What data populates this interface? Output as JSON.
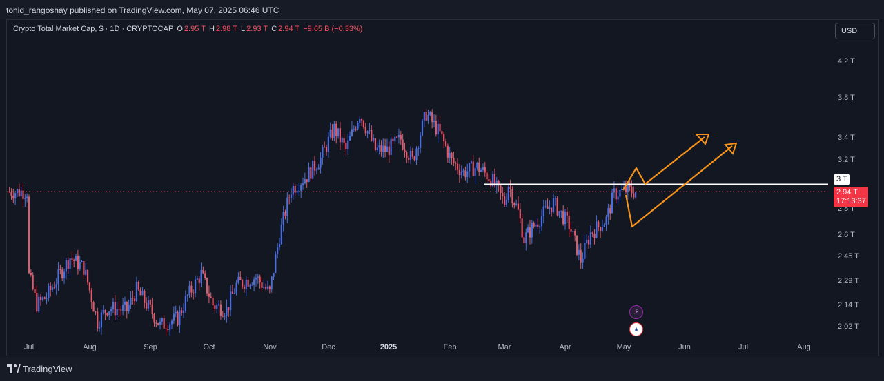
{
  "header": {
    "publisher_line": "tohid_rahgoshay published on TradingView.com, May 07, 2025 06:46 UTC"
  },
  "legend": {
    "title": "Crypto Total Market Cap, $ · 1D · CRYPTOCAP",
    "open_key": "O",
    "open": "2.95 T",
    "high_key": "H",
    "high": "2.98 T",
    "low_key": "L",
    "low": "2.93 T",
    "close_key": "C",
    "close": "2.94 T",
    "change": "−9.65 B (−0.33%)"
  },
  "currency_button": "USD",
  "price_axis": {
    "ticks": [
      "4.2 T",
      "3.8 T",
      "3.4 T",
      "3.2 T",
      "2.8 T",
      "2.6 T",
      "2.45 T",
      "2.29 T",
      "2.14 T",
      "2.02 T"
    ],
    "level_label": "3 T",
    "last_price": "2.94 T",
    "countdown": "17:13:37"
  },
  "time_axis": {
    "ticks": [
      "Jul",
      "Aug",
      "Sep",
      "Oct",
      "Nov",
      "Dec",
      "2025",
      "Feb",
      "Mar",
      "Apr",
      "May",
      "Jun",
      "Jul",
      "Aug"
    ]
  },
  "colors": {
    "up": "#4a6ee0",
    "down": "#e05a6c",
    "level_line": "#ffffff",
    "arrow": "#f7931a",
    "price_label_bg": "#f23645",
    "background": "#131722"
  },
  "events": [
    {
      "icon": "lightning-icon",
      "glyph": "⚡"
    },
    {
      "icon": "us-flag-icon",
      "glyph": "★"
    }
  ],
  "footer": {
    "brand": "TradingView"
  },
  "chart_data": {
    "type": "candlestick",
    "title": "Crypto Total Market Cap, $ · 1D · CRYPTOCAP",
    "unit": "T USD",
    "scale": "log",
    "ylim": [
      1.97,
      4.35
    ],
    "x_range": [
      "2024-07-01",
      "2025-08-31"
    ],
    "horizontal_level": 3.0,
    "last_close": 2.94,
    "points": [
      [
        "2024-07-01",
        2.33
      ],
      [
        "2024-07-05",
        2.15
      ],
      [
        "2024-07-10",
        2.2
      ],
      [
        "2024-07-15",
        2.3
      ],
      [
        "2024-07-22",
        2.45
      ],
      [
        "2024-07-29",
        2.38
      ],
      [
        "2024-08-05",
        2.05
      ],
      [
        "2024-08-10",
        2.13
      ],
      [
        "2024-08-20",
        2.12
      ],
      [
        "2024-08-25",
        2.24
      ],
      [
        "2024-09-01",
        2.12
      ],
      [
        "2024-09-06",
        2.03
      ],
      [
        "2024-09-15",
        2.07
      ],
      [
        "2024-09-20",
        2.2
      ],
      [
        "2024-09-27",
        2.34
      ],
      [
        "2024-10-03",
        2.15
      ],
      [
        "2024-10-10",
        2.12
      ],
      [
        "2024-10-15",
        2.27
      ],
      [
        "2024-10-20",
        2.3
      ],
      [
        "2024-10-25",
        2.32
      ],
      [
        "2024-11-01",
        2.22
      ],
      [
        "2024-11-06",
        2.6
      ],
      [
        "2024-11-12",
        2.96
      ],
      [
        "2024-11-20",
        3.07
      ],
      [
        "2024-11-27",
        3.22
      ],
      [
        "2024-12-04",
        3.5
      ],
      [
        "2024-12-10",
        3.3
      ],
      [
        "2024-12-17",
        3.65
      ],
      [
        "2024-12-25",
        3.3
      ],
      [
        "2024-12-31",
        3.3
      ],
      [
        "2025-01-07",
        3.4
      ],
      [
        "2025-01-13",
        3.2
      ],
      [
        "2025-01-20",
        3.65
      ],
      [
        "2025-01-27",
        3.45
      ],
      [
        "2025-02-02",
        3.2
      ],
      [
        "2025-02-08",
        3.1
      ],
      [
        "2025-02-15",
        3.15
      ],
      [
        "2025-02-22",
        3.05
      ],
      [
        "2025-03-01",
        2.85
      ],
      [
        "2025-03-03",
        3.0
      ],
      [
        "2025-03-08",
        2.78
      ],
      [
        "2025-03-11",
        2.58
      ],
      [
        "2025-03-20",
        2.75
      ],
      [
        "2025-03-26",
        2.85
      ],
      [
        "2025-04-03",
        2.68
      ],
      [
        "2025-04-09",
        2.43
      ],
      [
        "2025-04-14",
        2.62
      ],
      [
        "2025-04-22",
        2.72
      ],
      [
        "2025-04-26",
        2.92
      ],
      [
        "2025-05-02",
        2.95
      ],
      [
        "2025-05-07",
        2.94
      ]
    ]
  }
}
